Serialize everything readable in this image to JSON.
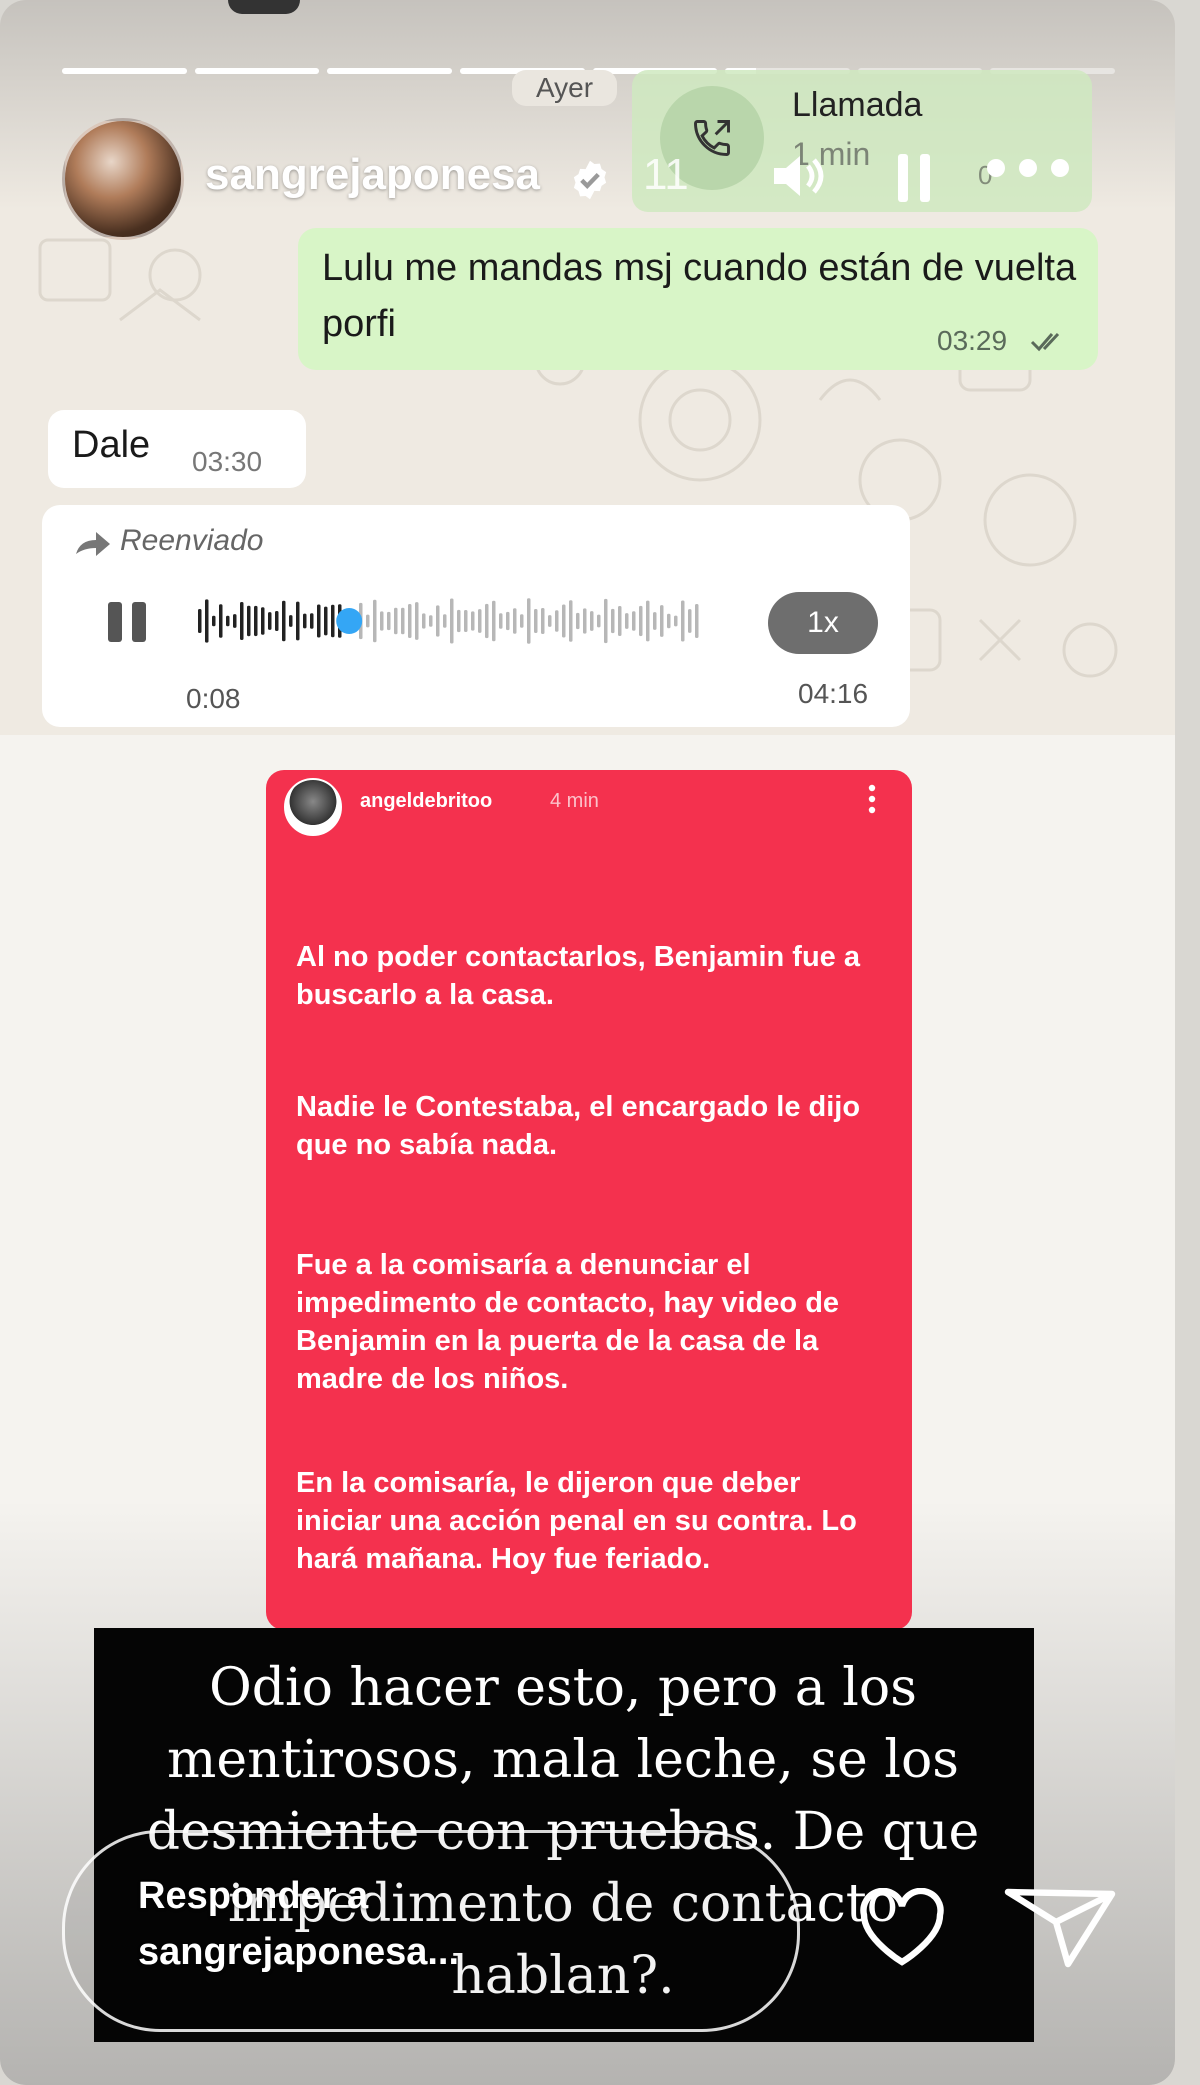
{
  "story": {
    "username": "sangrejaponesa",
    "time_ago": "11",
    "progress": [
      1,
      1,
      1,
      1,
      1,
      0.25,
      0,
      0
    ]
  },
  "chat": {
    "day_label": "Ayer",
    "call": {
      "title": "Llamada",
      "subtitle": "1 min",
      "small": "0"
    },
    "outgoing": {
      "text": "Lulu me mandas msj cuando están de vuelta porfi",
      "time": "03:29"
    },
    "incoming": {
      "text": "Dale",
      "time": "03:30"
    },
    "audio": {
      "forwarded_label": "Reenviado",
      "current": "0:08",
      "total": "04:16",
      "speed": "1x",
      "progress": 0.3
    }
  },
  "ig_post": {
    "username": "angeldebritoo",
    "time": "4 min",
    "paragraphs": [
      "Al no poder contactarlos, Benjamin fue a buscarlo a la casa.",
      "Nadie le Contestaba, el encargado le dijo que no sabía nada.",
      "Fue a la comisaría a denunciar el impedimento de contacto, hay video de Benjamin en la puerta de la casa de la  madre de los niños.",
      "En la comisaría, le dijeron que deber iniciar una acción penal en su contra. Lo hará mañana. Hoy fue feriado."
    ]
  },
  "caption": {
    "text": "Odio hacer esto, pero a los mentirosos, mala leche, se los desmiente con pruebas. De que impedimento de contacto hablan?."
  },
  "reply": {
    "placeholder": "Responder a sangrejaponesa..."
  },
  "colors": {
    "ig_red": "#f4314e",
    "wa_green": "#d8f5c7",
    "caption_bg": "#050505"
  }
}
